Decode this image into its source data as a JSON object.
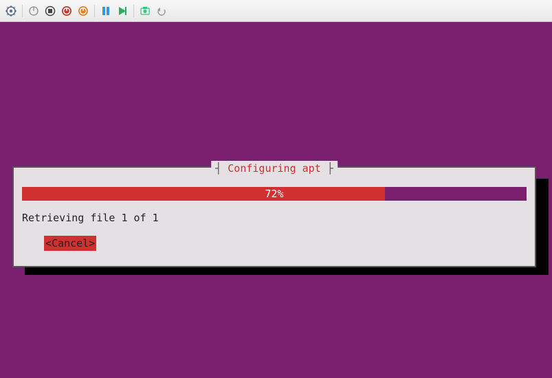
{
  "toolbar": {
    "icons": [
      {
        "name": "settings-icon",
        "color": "#5a6a8a"
      },
      {
        "name": "power-icon",
        "color": "#999"
      },
      {
        "name": "stop-icon",
        "color": "#444"
      },
      {
        "name": "reset-icon",
        "color": "#c0392b"
      },
      {
        "name": "shutdown-icon",
        "color": "#e67e22"
      },
      {
        "name": "pause-icon",
        "color": "#3498db"
      },
      {
        "name": "play-icon",
        "color": "#27ae60"
      },
      {
        "name": "snapshot-icon",
        "color": "#2ecc71"
      },
      {
        "name": "undo-icon",
        "color": "#999"
      }
    ]
  },
  "dialog": {
    "title": "Configuring apt",
    "progress": {
      "percent": 72,
      "label": "72%"
    },
    "status": "Retrieving file 1 of 1",
    "cancel": "<Cancel>"
  },
  "colors": {
    "console_bg": "#7a1f6e",
    "dialog_bg": "#e4e0e4",
    "accent_red": "#d03030"
  }
}
